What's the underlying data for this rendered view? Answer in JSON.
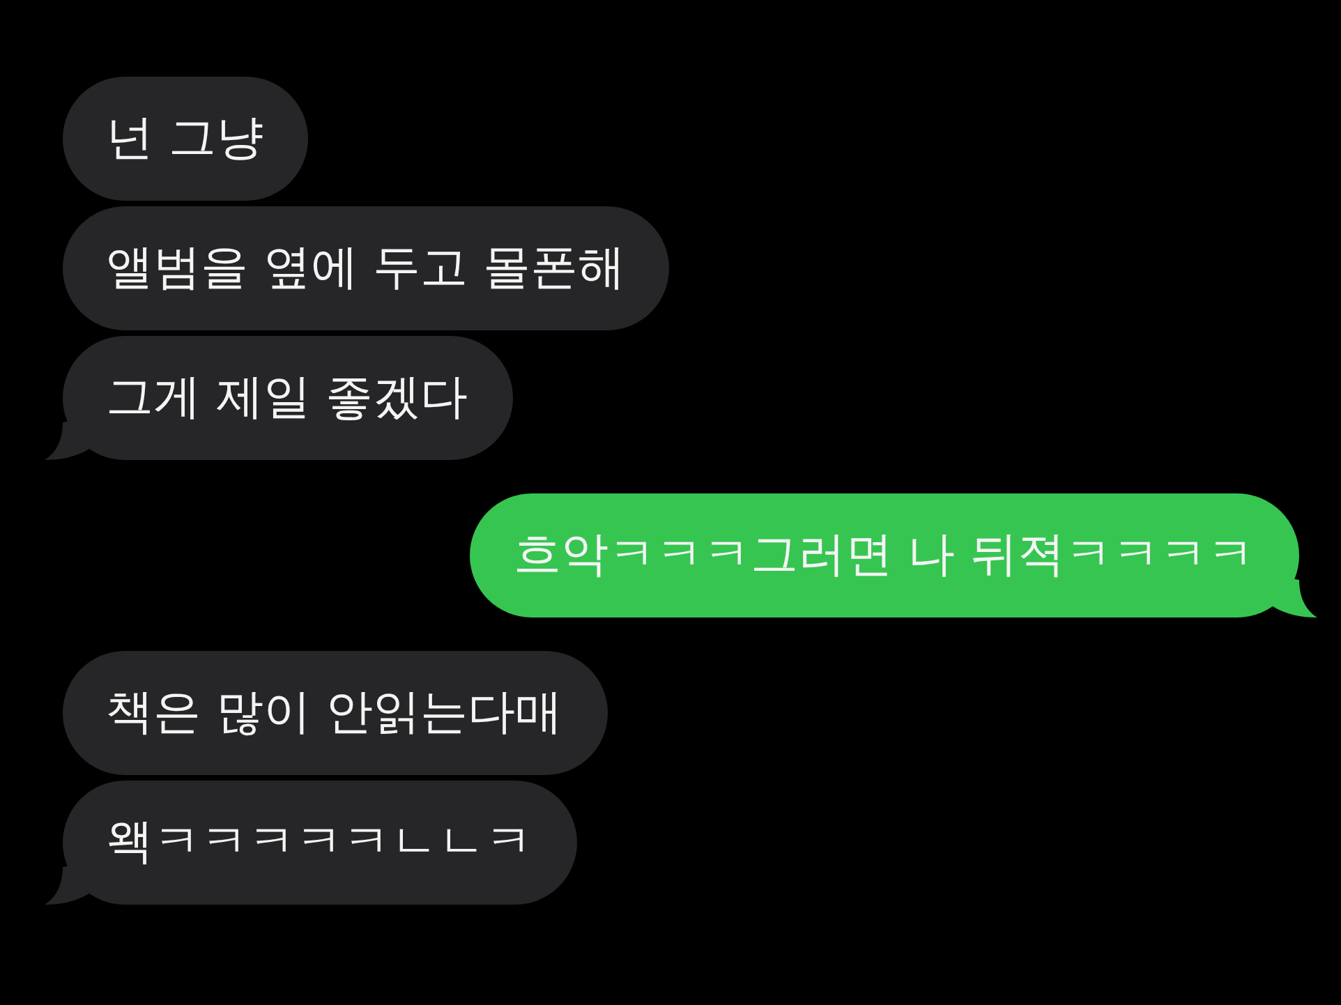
{
  "messages": [
    {
      "kind": "incoming",
      "text": "넌 그냥",
      "tail": false
    },
    {
      "kind": "incoming",
      "text": "앨범을 옆에 두고 몰폰해",
      "tail": false
    },
    {
      "kind": "incoming",
      "text": "그게 제일 좋겠다",
      "tail": true
    },
    {
      "kind": "outgoing",
      "text": "흐악ㅋㅋㅋ그러면 나 뒤젹ㅋㅋㅋㅋ",
      "tail": true
    },
    {
      "kind": "incoming",
      "text": "책은 많이 안읽는다매",
      "tail": false
    },
    {
      "kind": "incoming",
      "text": "왝ㅋㅋㅋㅋㅋㄴㄴㅋ",
      "tail": true
    }
  ]
}
